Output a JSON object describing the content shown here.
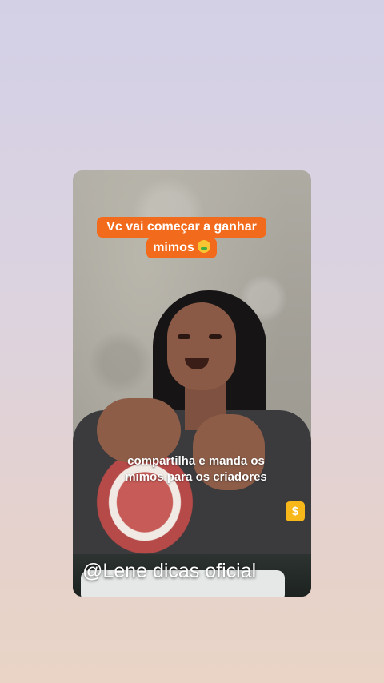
{
  "story": {
    "caption_top_line1": "Vc vai começar a ganhar",
    "caption_top_line2": "mimos",
    "caption_top_emoji": "money-mouth-face-icon",
    "caption_mid_line1": "compartilha e manda os",
    "caption_mid_line2": "mimos para os criadores",
    "gift_badge": "$",
    "watermark": "@Lene dicas oficial"
  },
  "colors": {
    "caption_bg": "#f26a1b",
    "badge_bg": "#f9b81a"
  }
}
